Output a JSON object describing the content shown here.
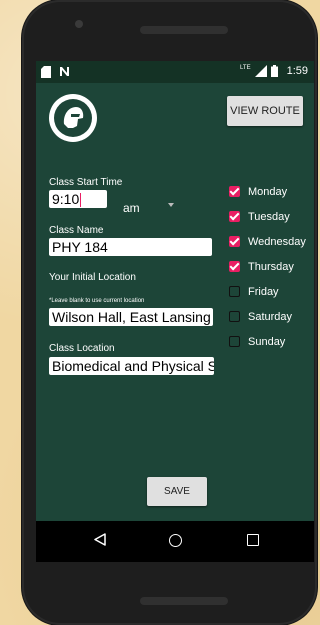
{
  "status_bar": {
    "time": "1:59",
    "lte": "LTE",
    "icons": [
      "sim-card-icon",
      "n-notification-icon",
      "signal-icon",
      "battery-icon"
    ]
  },
  "header": {
    "logo": "spartan-helmet-logo",
    "view_route_label": "VIEW ROUTE"
  },
  "form": {
    "start_time_label": "Class Start Time",
    "start_time_value": "9:10",
    "ampm_value": "am",
    "class_name_label": "Class Name",
    "class_name_value": "PHY 184",
    "initial_location_label": "Your Initial Location",
    "initial_location_hint": "*Leave blank to use current location",
    "initial_location_value": "Wilson Hall, East Lansing",
    "class_location_label": "Class Location",
    "class_location_value": "Biomedical and Physical Sciences"
  },
  "days": [
    {
      "label": "Monday",
      "checked": true
    },
    {
      "label": "Tuesday",
      "checked": true
    },
    {
      "label": "Wednesday",
      "checked": true
    },
    {
      "label": "Thursday",
      "checked": true
    },
    {
      "label": "Friday",
      "checked": false
    },
    {
      "label": "Saturday",
      "checked": false
    },
    {
      "label": "Sunday",
      "checked": false
    }
  ],
  "save_label": "SAVE",
  "colors": {
    "screen_bg": "#1d4538",
    "status_bar": "#143225",
    "accent": "#e91e63",
    "button_bg": "#e0e0e0"
  },
  "nav": {
    "icons": [
      "back-icon",
      "home-icon",
      "recents-icon"
    ]
  }
}
